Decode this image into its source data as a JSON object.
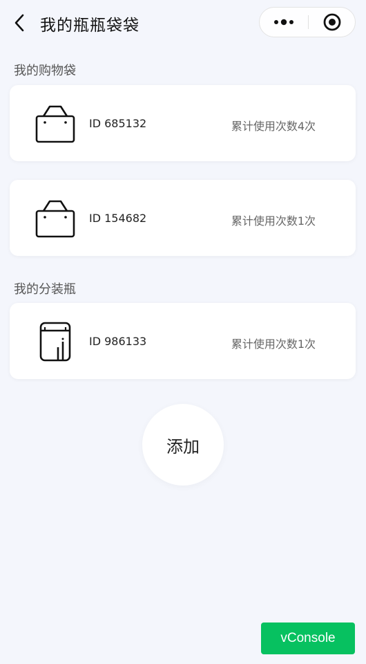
{
  "nav": {
    "title": "我的瓶瓶袋袋"
  },
  "sections": {
    "bags_title": "我的购物袋",
    "bottles_title": "我的分装瓶"
  },
  "bags": [
    {
      "id_text": "ID 685132",
      "usage": "累计使用次数4次",
      "icon": "shopping-bag-icon"
    },
    {
      "id_text": "ID 154682",
      "usage": "累计使用次数1次",
      "icon": "shopping-bag-icon"
    }
  ],
  "bottles": [
    {
      "id_text": "ID 986133",
      "usage": "累计使用次数1次",
      "icon": "bottle-icon"
    }
  ],
  "add_button": {
    "label": "添加"
  },
  "vconsole": {
    "label": "vConsole",
    "color": "#07c160"
  }
}
